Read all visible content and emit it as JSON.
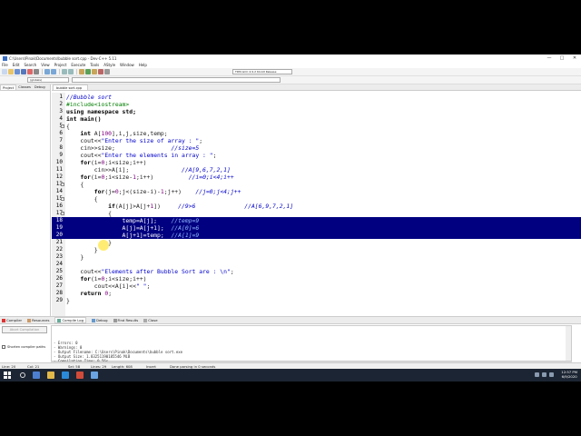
{
  "window": {
    "title": "C:\\Users\\Pinak\\Documents\\bubble sort.cpp - Dev-C++ 5.11",
    "controls": [
      "—",
      "□",
      "✕"
    ]
  },
  "menu": [
    "File",
    "Edit",
    "Search",
    "View",
    "Project",
    "Execute",
    "Tools",
    "AStyle",
    "Window",
    "Help"
  ],
  "toolbar": {
    "compiler": "TDM-GCC 4.9.2 64-bit Release",
    "globals": "(globals)"
  },
  "left_panel": {
    "tabs": [
      "Project",
      "Classes",
      "Debug"
    ]
  },
  "editor": {
    "file_tab": "bubble sort.cpp",
    "lines": [
      {
        "n": "1",
        "segs": [
          {
            "t": "//Bubble sort",
            "c": "com"
          }
        ]
      },
      {
        "n": "2",
        "segs": [
          {
            "t": "#include<iostream>",
            "c": "pre"
          }
        ]
      },
      {
        "n": "3",
        "segs": [
          {
            "t": "using namespace std;",
            "c": "kw"
          }
        ]
      },
      {
        "n": "4",
        "segs": [
          {
            "t": "int main()",
            "c": "kw"
          }
        ]
      },
      {
        "n": "5",
        "fold": "-",
        "segs": [
          {
            "t": "{",
            "c": ""
          }
        ]
      },
      {
        "n": "6",
        "segs": [
          {
            "t": "    ",
            "c": ""
          },
          {
            "t": "int",
            "c": "kw"
          },
          {
            "t": " A[",
            "c": ""
          },
          {
            "t": "100",
            "c": "num"
          },
          {
            "t": "],i,j,size,temp;",
            "c": ""
          }
        ]
      },
      {
        "n": "7",
        "segs": [
          {
            "t": "    cout<<",
            "c": ""
          },
          {
            "t": "\"Enter the size of array : \"",
            "c": "str"
          },
          {
            "t": ";",
            "c": ""
          }
        ]
      },
      {
        "n": "8",
        "segs": [
          {
            "t": "    cin>>size;                ",
            "c": ""
          },
          {
            "t": "//size=5",
            "c": "com"
          }
        ]
      },
      {
        "n": "9",
        "segs": [
          {
            "t": "    cout<<",
            "c": ""
          },
          {
            "t": "\"Enter the elements in array : \"",
            "c": "str"
          },
          {
            "t": ";",
            "c": ""
          }
        ]
      },
      {
        "n": "10",
        "segs": [
          {
            "t": "    ",
            "c": ""
          },
          {
            "t": "for",
            "c": "kw"
          },
          {
            "t": "(i=",
            "c": ""
          },
          {
            "t": "0",
            "c": "num"
          },
          {
            "t": ";i<size;i++)",
            "c": ""
          }
        ]
      },
      {
        "n": "11",
        "segs": [
          {
            "t": "        cin>>A[i];               ",
            "c": ""
          },
          {
            "t": "//A[9,6,7,2,1]",
            "c": "com"
          }
        ]
      },
      {
        "n": "12",
        "segs": [
          {
            "t": "    ",
            "c": ""
          },
          {
            "t": "for",
            "c": "kw"
          },
          {
            "t": "(i=",
            "c": ""
          },
          {
            "t": "0",
            "c": "num"
          },
          {
            "t": ";i<size-",
            "c": ""
          },
          {
            "t": "1",
            "c": "num"
          },
          {
            "t": ";i++)          ",
            "c": ""
          },
          {
            "t": "//i=0;i<4;i++",
            "c": "com"
          }
        ]
      },
      {
        "n": "13",
        "fold": "-",
        "segs": [
          {
            "t": "    {",
            "c": ""
          }
        ]
      },
      {
        "n": "14",
        "segs": [
          {
            "t": "        ",
            "c": ""
          },
          {
            "t": "for",
            "c": "kw"
          },
          {
            "t": "(j=",
            "c": ""
          },
          {
            "t": "0",
            "c": "num"
          },
          {
            "t": ";j<(size-i)-",
            "c": ""
          },
          {
            "t": "1",
            "c": "num"
          },
          {
            "t": ";j++)    ",
            "c": ""
          },
          {
            "t": "//j=0;j<4;j++",
            "c": "com"
          }
        ]
      },
      {
        "n": "15",
        "fold": "-",
        "segs": [
          {
            "t": "        {",
            "c": ""
          }
        ]
      },
      {
        "n": "16",
        "segs": [
          {
            "t": "            ",
            "c": ""
          },
          {
            "t": "if",
            "c": "kw"
          },
          {
            "t": "(A[j]>A[j+",
            "c": ""
          },
          {
            "t": "1",
            "c": "num"
          },
          {
            "t": "])     ",
            "c": ""
          },
          {
            "t": "//9>6              //A[6,9,7,2,1]",
            "c": "com"
          }
        ]
      },
      {
        "n": "17",
        "fold": "-",
        "segs": [
          {
            "t": "            {",
            "c": ""
          }
        ]
      },
      {
        "n": "18",
        "hl": true,
        "segs": [
          {
            "t": "                temp=A[j];    ",
            "c": ""
          },
          {
            "t": "//temp=9",
            "c": "hlcom"
          }
        ]
      },
      {
        "n": "19",
        "hl": true,
        "segs": [
          {
            "t": "                A[j]=A[j+1];  ",
            "c": ""
          },
          {
            "t": "//A[0]=6",
            "c": "hlcom"
          }
        ]
      },
      {
        "n": "20",
        "hl": true,
        "segs": [
          {
            "t": "                A[j+1]=temp;  ",
            "c": ""
          },
          {
            "t": "//A[1]=9",
            "c": "hlcom"
          }
        ]
      },
      {
        "n": "21",
        "segs": [
          {
            "t": "            }",
            "c": ""
          }
        ]
      },
      {
        "n": "22",
        "segs": [
          {
            "t": "        }",
            "c": ""
          }
        ]
      },
      {
        "n": "23",
        "segs": [
          {
            "t": "    }",
            "c": ""
          }
        ]
      },
      {
        "n": "24",
        "segs": [
          {
            "t": "",
            "c": ""
          }
        ]
      },
      {
        "n": "25",
        "segs": [
          {
            "t": "    cout<<",
            "c": ""
          },
          {
            "t": "\"Elements after Bubble Sort are : \\n\"",
            "c": "str"
          },
          {
            "t": ";",
            "c": ""
          }
        ]
      },
      {
        "n": "26",
        "segs": [
          {
            "t": "    ",
            "c": ""
          },
          {
            "t": "for",
            "c": "kw"
          },
          {
            "t": "(i=",
            "c": ""
          },
          {
            "t": "0",
            "c": "num"
          },
          {
            "t": ";i<size;i++)",
            "c": ""
          }
        ]
      },
      {
        "n": "27",
        "segs": [
          {
            "t": "        cout<<A[i]<<",
            "c": ""
          },
          {
            "t": "\" \"",
            "c": "str"
          },
          {
            "t": ";",
            "c": ""
          }
        ]
      },
      {
        "n": "28",
        "segs": [
          {
            "t": "    ",
            "c": ""
          },
          {
            "t": "return",
            "c": "kw"
          },
          {
            "t": " ",
            "c": ""
          },
          {
            "t": "0",
            "c": "num"
          },
          {
            "t": ";",
            "c": ""
          }
        ]
      },
      {
        "n": "29",
        "segs": [
          {
            "t": "}",
            "c": ""
          }
        ]
      }
    ]
  },
  "bottom_tabs": [
    "Compiler",
    "Resources",
    "Compile Log",
    "Debug",
    "Find Results",
    "Close"
  ],
  "bottom_panel": {
    "abort_label": "Abort Compilation",
    "shorten_label": "Shorten compiler paths",
    "log": [
      "- Errors: 0",
      "- Warnings: 0",
      "- Output Filename: C:\\Users\\Pinak\\Documents\\bubble sort.exe",
      "- Output Size: 1.83251190185546 MiB",
      "- Compilation Time: 0.56s"
    ]
  },
  "status": {
    "line": "Line: 20",
    "col": "Col: 21",
    "sel": "Sel: 58",
    "lines": "Lines: 29",
    "length": "Length: 608",
    "mode": "Insert",
    "message": "Done parsing in 0 seconds"
  },
  "tray": {
    "time": "12:57 PM",
    "date": "6/9/2020"
  },
  "colors": {
    "selection": "#000080",
    "taskbar": "#1c2533",
    "comment": "#0000cc",
    "preprocessor": "#007f00"
  }
}
